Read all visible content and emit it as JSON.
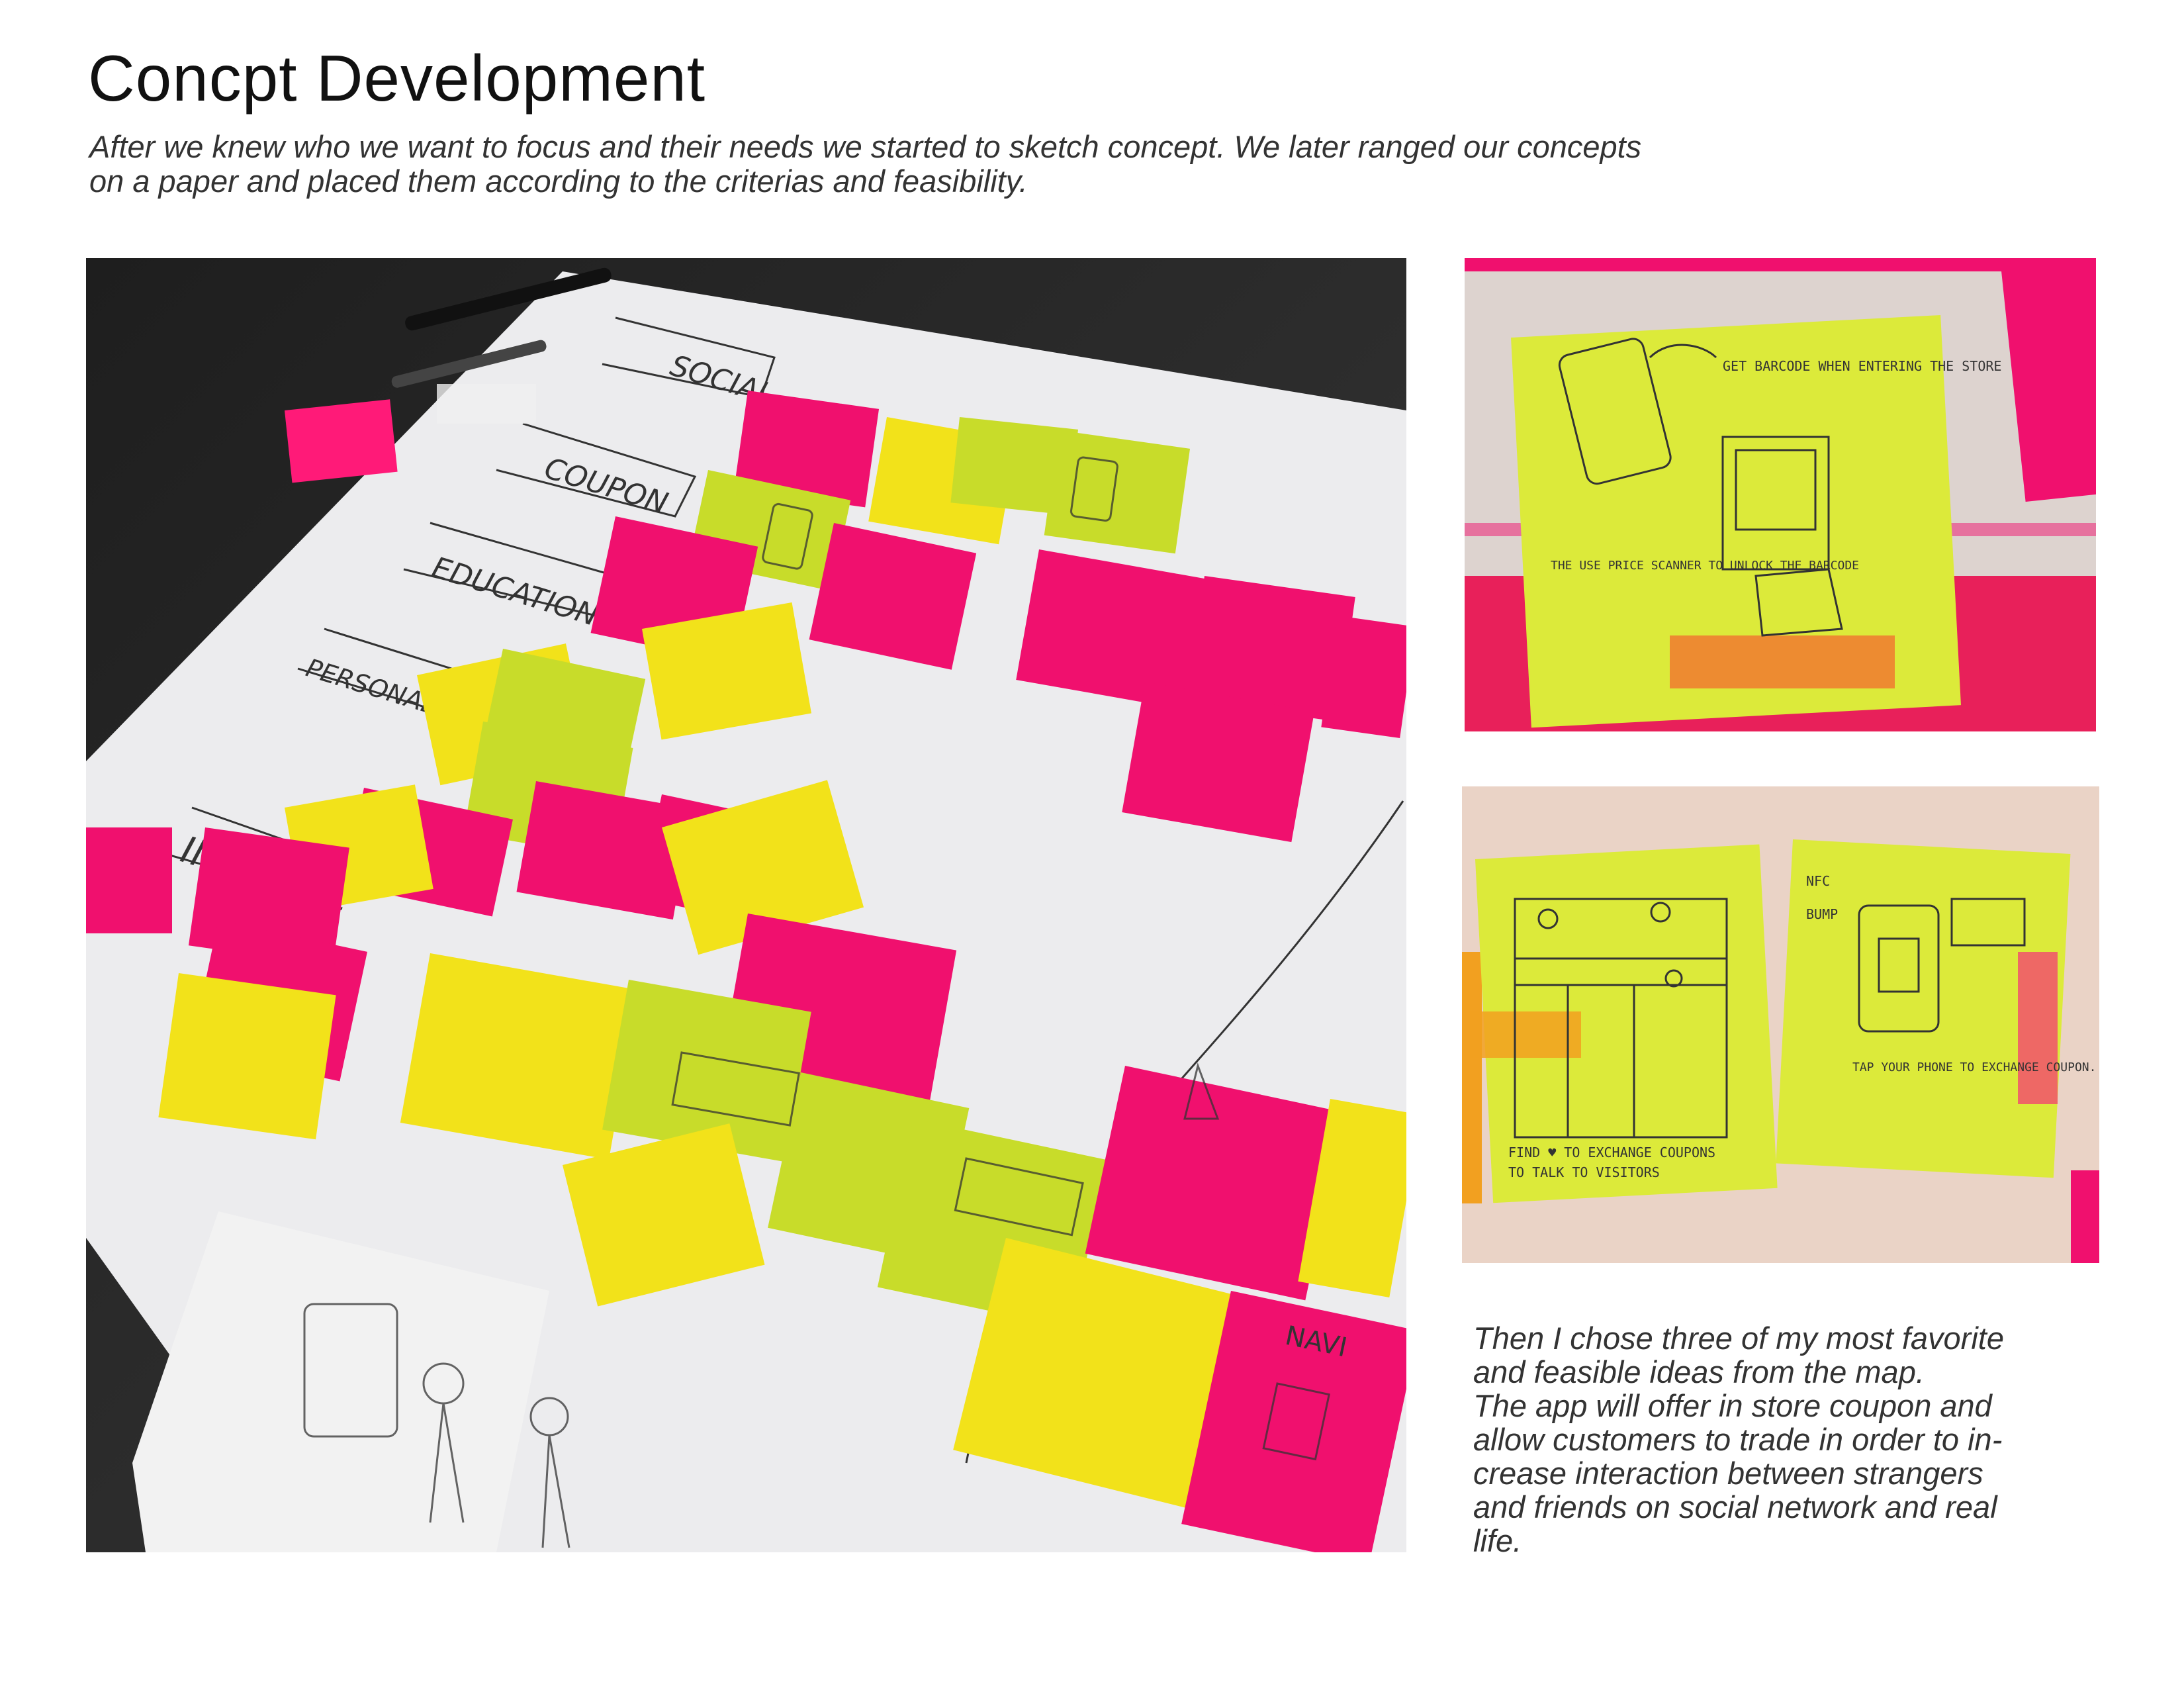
{
  "page": {
    "title": "Concpt Development",
    "intro_lines": [
      "After we knew who we want to focus and their needs we started to sketch concept. We later ranged our concepts",
      "on a paper and placed them according to the criterias and feasibility."
    ],
    "caption_lines": [
      "Then I chose three of my most favorite",
      "and feasible ideas from the map.",
      "The app will offer in store coupon and",
      "allow customers to trade in order to in-",
      "crease interaction between strangers",
      "and friends on social network and real",
      "life."
    ]
  },
  "photos": {
    "main": {
      "row_labels": [
        "SOCIAL",
        "COUPON",
        "EDUCATION",
        "PERSONALIZATION",
        "IN STORE"
      ],
      "note_texts": [
        "NAVI"
      ]
    },
    "closeup_a": {
      "sticky_texts": [
        "GET BARCODE WHEN ENTERING THE STORE",
        "THE USE PRICE SCANNER TO UNLOCK THE BARCODE"
      ]
    },
    "closeup_b": {
      "sticky_texts": [
        "FIND ♥ TO EXCHANGE COUPONS",
        "TO TALK TO VISITORS",
        "NFC",
        "BUMP",
        "TAP YOUR PHONE TO EXCHANGE COUPON."
      ]
    }
  },
  "colors": {
    "pink_note": "#f0106e",
    "yellow_note": "#f2e21a",
    "lime_note": "#c8dc2a",
    "paper": "#ededee",
    "table": "#2a2a2a"
  }
}
